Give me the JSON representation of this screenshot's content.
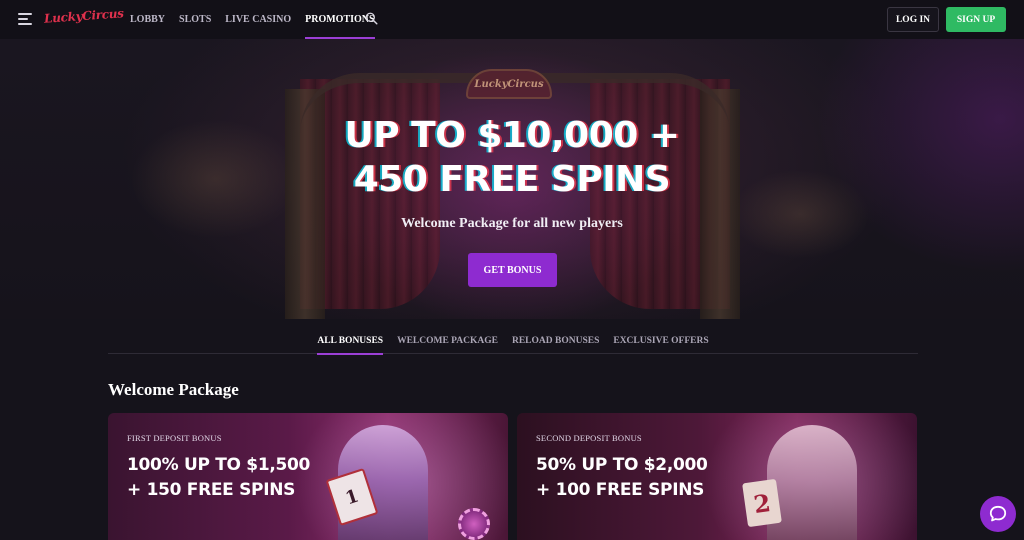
{
  "header": {
    "logo_text": "LuckyCircus",
    "nav": [
      "LOBBY",
      "SLOTS",
      "LIVE CASINO",
      "PROMOTIONS"
    ],
    "active_nav": "PROMOTIONS",
    "login_label": "LOG IN",
    "signup_label": "SIGN UP"
  },
  "hero": {
    "sign_text": "LuckyCircus",
    "title_line1": "UP TO $10,000 +",
    "title_line2": "450 FREE SPINS",
    "subtitle": "Welcome Package for all new players",
    "button_label": "GET BONUS"
  },
  "tabs": [
    "ALL BONUSES",
    "WELCOME PACKAGE",
    "RELOAD BONUSES",
    "EXCLUSIVE OFFERS"
  ],
  "active_tab": "ALL BONUSES",
  "section": {
    "title": "Welcome Package"
  },
  "cards": [
    {
      "label": "FIRST DEPOSIT BONUS",
      "title_line1": "100% UP TO $1,500",
      "title_line2": "+ 150 FREE SPINS",
      "prop_text": "1"
    },
    {
      "label": "SECOND DEPOSIT BONUS",
      "title_line1": "50% UP TO $2,000",
      "title_line2": "+ 100 FREE SPINS",
      "prop_text": "2"
    }
  ],
  "icons": {
    "menu": "hamburger-menu-icon",
    "search": "search-icon",
    "chat": "chat-bubble-icon"
  },
  "colors": {
    "accent": "#8e2bd0",
    "signup": "#2fba63",
    "logo": "#e0314d"
  }
}
